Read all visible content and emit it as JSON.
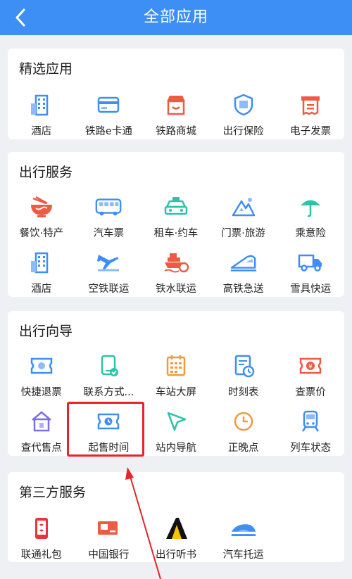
{
  "header": {
    "title": "全部应用"
  },
  "sections": [
    {
      "title": "精选应用",
      "rows": [
        [
          {
            "label": "酒店",
            "icon": "hotel-icon"
          },
          {
            "label": "铁路e卡通",
            "icon": "card-icon"
          },
          {
            "label": "铁路商城",
            "icon": "shop-icon"
          },
          {
            "label": "出行保险",
            "icon": "insurance-shield-icon"
          },
          {
            "label": "电子发票",
            "icon": "invoice-icon"
          }
        ]
      ]
    },
    {
      "title": "出行服务",
      "rows": [
        [
          {
            "label": "餐饮·特产",
            "icon": "noodle-bowl-icon"
          },
          {
            "label": "汽车票",
            "icon": "bus-icon"
          },
          {
            "label": "租车·约车",
            "icon": "taxi-icon"
          },
          {
            "label": "门票·旅游",
            "icon": "mountain-icon"
          },
          {
            "label": "乘意险",
            "icon": "umbrella-icon"
          }
        ],
        [
          {
            "label": "酒店",
            "icon": "hotel-icon"
          },
          {
            "label": "空铁联运",
            "icon": "plane-train-icon"
          },
          {
            "label": "铁水联运",
            "icon": "ship-train-icon"
          },
          {
            "label": "高铁急送",
            "icon": "highspeed-train-icon"
          },
          {
            "label": "雪具快运",
            "icon": "truck-icon"
          }
        ]
      ]
    },
    {
      "title": "出行向导",
      "rows": [
        [
          {
            "label": "快捷退票",
            "icon": "refund-ticket-icon"
          },
          {
            "label": "联系方式...",
            "icon": "phone-contact-icon"
          },
          {
            "label": "车站大屏",
            "icon": "station-screen-icon"
          },
          {
            "label": "时刻表",
            "icon": "timetable-icon"
          },
          {
            "label": "查票价",
            "icon": "ticket-price-icon"
          }
        ],
        [
          {
            "label": "查代售点",
            "icon": "agency-house-icon"
          },
          {
            "label": "起售时间",
            "icon": "sale-time-ticket-icon"
          },
          {
            "label": "站内导航",
            "icon": "navigation-arrow-icon"
          },
          {
            "label": "正晚点",
            "icon": "clock-icon"
          },
          {
            "label": "列车状态",
            "icon": "train-status-icon"
          }
        ]
      ]
    },
    {
      "title": "第三方服务",
      "rows": [
        [
          {
            "label": "联通礼包",
            "icon": "unicom-gift-icon"
          },
          {
            "label": "中国银行",
            "icon": "bank-card-icon"
          },
          {
            "label": "出行听书",
            "icon": "audiobook-icon"
          },
          {
            "label": "汽车托运",
            "icon": "car-shipping-icon"
          }
        ]
      ]
    }
  ],
  "colors": {
    "header_bg": "#3d8ef5",
    "highlight": "#e8232a",
    "icon_blue": "#3d8ef5",
    "icon_red": "#ef5a42"
  }
}
